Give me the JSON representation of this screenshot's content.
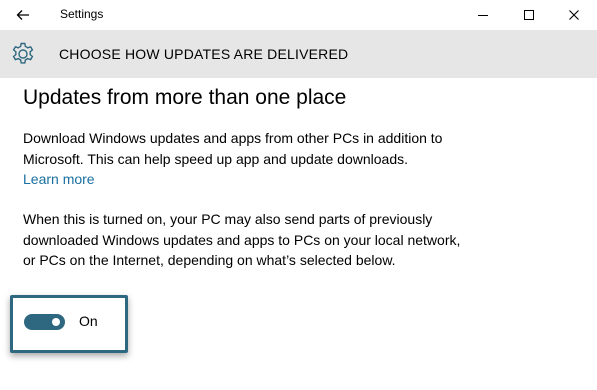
{
  "window": {
    "title": "Settings",
    "back_icon": "back-arrow-icon",
    "minimize_icon": "minimize-icon",
    "maximize_icon": "maximize-icon",
    "close_icon": "close-icon"
  },
  "header": {
    "icon": "gear-icon",
    "title": "CHOOSE HOW UPDATES ARE DELIVERED"
  },
  "main": {
    "heading": "Updates from more than one place",
    "paragraph1": "Download Windows updates and apps from other PCs in addition to Microsoft. This can help speed up app and update downloads.",
    "learn_more": "Learn more",
    "paragraph2": "When this is turned on, your PC may also send parts of previously downloaded Windows updates and apps to PCs on your local network, or PCs on the Internet, depending on what’s selected below."
  },
  "toggle": {
    "state_label": "On",
    "is_on": true
  },
  "colors": {
    "accent": "#2e6880",
    "header_bg": "#e6e6e6",
    "link": "#1a6fa0"
  }
}
